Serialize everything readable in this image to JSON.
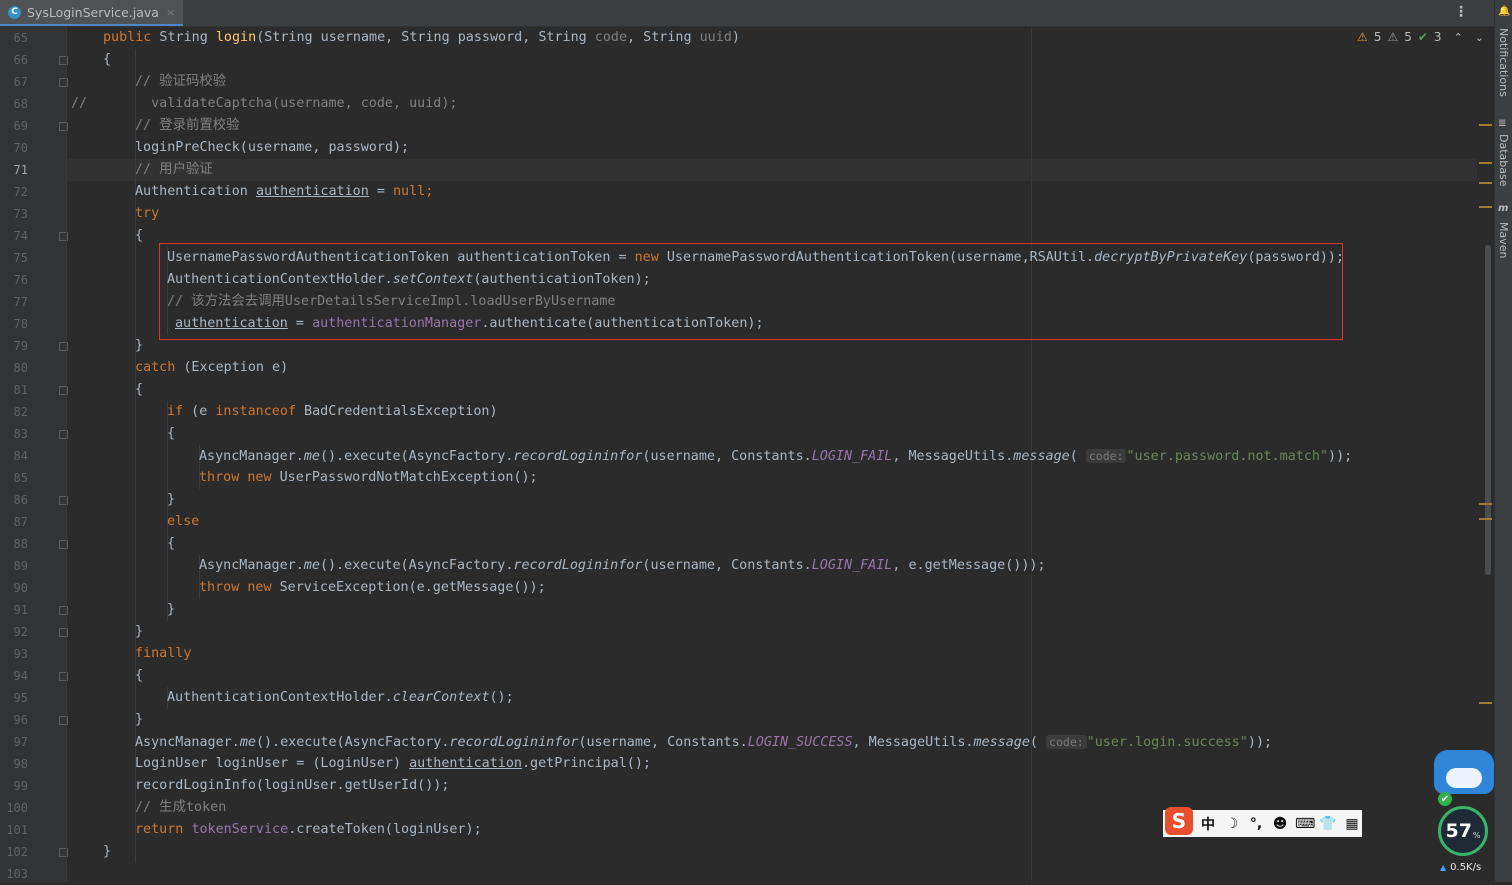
{
  "tab": {
    "icon": "C",
    "filename": "SysLoginService.java",
    "close": "×"
  },
  "toolbar": {
    "menu": "⋮"
  },
  "inspections": {
    "warnings": "5",
    "weak_warnings": "5",
    "typos": "3",
    "up": "⌃",
    "down": "⌄"
  },
  "side_panels": {
    "notifications": "Notifications",
    "database": "Database",
    "maven": "Maven"
  },
  "line_numbers": [
    "65",
    "66",
    "67",
    "68",
    "69",
    "70",
    "71",
    "72",
    "73",
    "74",
    "75",
    "76",
    "77",
    "78",
    "79",
    "80",
    "81",
    "82",
    "83",
    "84",
    "85",
    "86",
    "87",
    "88",
    "89",
    "90",
    "91",
    "92",
    "93",
    "94",
    "95",
    "96",
    "97",
    "98",
    "99",
    "100",
    "101",
    "102",
    "103"
  ],
  "current_line": "71",
  "code": {
    "l65": {
      "kw1": "public",
      "t1": " String ",
      "fn": "login",
      "t2": "(String username, String password, String ",
      "p1": "code",
      "t3": ", String ",
      "p2": "uuid",
      "t4": ")"
    },
    "l66": "{",
    "l67": "// 验证码校验",
    "l68_prefix": "//",
    "l68": "  validateCaptcha(username, code, uuid);",
    "l69": "// 登录前置校验",
    "l70": "loginPreCheck(username, password);",
    "l71": "// 用户验证",
    "l72": {
      "t1": "Authentication ",
      "var": "authentication",
      "t2": " = ",
      "kw": "null",
      "t3": ";"
    },
    "l73": "try",
    "l74": "{",
    "l75": {
      "t1": "UsernamePasswordAuthenticationToken authenticationToken = ",
      "kw": "new",
      "t2": " UsernamePasswordAuthenticationToken(username,RSAUtil.",
      "m": "decryptByPrivateKey",
      "t3": "(password));"
    },
    "l76": {
      "t1": "AuthenticationContextHolder.",
      "m": "setContext",
      "t2": "(authenticationToken);"
    },
    "l77": "// 该方法会去调用UserDetailsServiceImpl.loadUserByUsername",
    "l78": {
      "var": "authentication",
      "t1": " = ",
      "fld": "authenticationManager",
      "t2": ".authenticate(authenticationToken);"
    },
    "l79": "}",
    "l80": {
      "kw": "catch",
      "t": " (Exception e)"
    },
    "l81": "{",
    "l82": {
      "kw1": "if",
      "t1": " (e ",
      "kw2": "instanceof",
      "t2": " BadCredentialsException)"
    },
    "l83": "{",
    "l84": {
      "t1": "AsyncManager.",
      "m1": "me",
      "t2": "().execute(AsyncFactory.",
      "m2": "recordLogininfor",
      "t3": "(username, Constants.",
      "c": "LOGIN_FAIL",
      "t4": ", MessageUtils.",
      "m3": "message",
      "t5": "( ",
      "hint": "code:",
      "s": "\"user.password.not.match\"",
      "t6": "));"
    },
    "l85": {
      "kw1": "throw",
      "kw2": "new",
      "t": " UserPasswordNotMatchException();"
    },
    "l86": "}",
    "l87": "else",
    "l88": "{",
    "l89": {
      "t1": "AsyncManager.",
      "m1": "me",
      "t2": "().execute(AsyncFactory.",
      "m2": "recordLogininfor",
      "t3": "(username, Constants.",
      "c": "LOGIN_FAIL",
      "t4": ", e.getMessage()));"
    },
    "l90": {
      "kw1": "throw",
      "kw2": "new",
      "t": " ServiceException(e.getMessage());"
    },
    "l91": "}",
    "l92": "}",
    "l93": "finally",
    "l94": "{",
    "l95": {
      "t1": "AuthenticationContextHolder.",
      "m": "clearContext",
      "t2": "();"
    },
    "l96": "}",
    "l97": {
      "t1": "AsyncManager.",
      "m1": "me",
      "t2": "().execute(AsyncFactory.",
      "m2": "recordLogininfor",
      "t3": "(username, Constants.",
      "c": "LOGIN_SUCCESS",
      "t4": ", MessageUtils.",
      "m3": "message",
      "t5": "( ",
      "hint": "code:",
      "s": "\"user.login.success\"",
      "t6": "));"
    },
    "l98": {
      "t1": "LoginUser loginUser = (LoginUser) ",
      "var": "authentication",
      "t2": ".getPrincipal();"
    },
    "l99": "recordLoginInfo(loginUser.getUserId());",
    "l100": "// 生成token",
    "l101": {
      "kw": "return",
      "fld": "tokenService",
      "t": ".createToken(loginUser);"
    },
    "l102": "}"
  },
  "ime_toolbar": {
    "logo": "S",
    "mode": "中",
    "moon": "☽",
    "punct": "°,",
    "emoji": "☻",
    "keyboard": "⌨",
    "skin": "👕",
    "apps": "▦"
  },
  "monitor_widget": {
    "cpu_percent": "57",
    "percent_sign": "%",
    "speed": "0.5K/s",
    "check": "✔"
  },
  "colors": {
    "background": "#2b2b2b",
    "keyword": "#cc7832",
    "comment": "#808080",
    "string": "#6a8759",
    "method": "#ffc66d",
    "field": "#9876aa",
    "highlight_box": "#e0343a"
  }
}
